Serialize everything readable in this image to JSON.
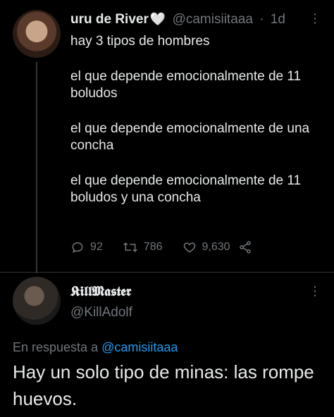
{
  "tweet1": {
    "display_name": "uru de River",
    "name_emoji": "🤍",
    "handle": "@camisiitaaa",
    "dot": "·",
    "time": "1d",
    "more": "⋮",
    "lines": [
      "hay 3 tipos de hombres",
      "el que depende emocionalmente de 11 boludos",
      "el que depende emocionalmente de una concha",
      "el que depende emocionalmente de 11 boludos y una concha"
    ],
    "replies": "92",
    "retweets": "786",
    "likes": "9,630"
  },
  "tweet2": {
    "display_name": "𝕶𝖎𝖑𝖑𝕸𝖆𝖘𝖙𝖊𝖗",
    "handle": "@KillAdolf",
    "more": "⋮",
    "reply_prefix": "En respuesta a",
    "reply_to": "@camisiitaaa",
    "text": "Hay un solo tipo de minas: las rompe huevos."
  },
  "colors": {
    "background": "#000000",
    "text": "#e7e9ea",
    "muted": "#71767b",
    "link": "#1d9bf0"
  },
  "icons": [
    "reply-icon",
    "retweet-icon",
    "like-icon",
    "share-icon",
    "more-icon"
  ]
}
